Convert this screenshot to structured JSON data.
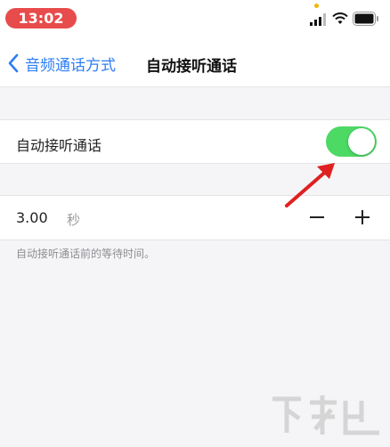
{
  "status": {
    "time": "13:02"
  },
  "nav": {
    "back_label": "音频通话方式",
    "title": "自动接听通话"
  },
  "auto_answer": {
    "label": "自动接听通话",
    "enabled": true
  },
  "delay": {
    "value": "3.00",
    "unit": "秒",
    "minus_label": "−",
    "plus_label": "+"
  },
  "footnote": "自动接听通话前的等待时间。",
  "colors": {
    "time_pill": "#e84b4b",
    "link_blue": "#2d7df6",
    "toggle_on": "#4cd964",
    "annotation_red": "#e02020"
  },
  "icons": {
    "back": "chevron-left-icon",
    "signal": "cellular-signal-icon",
    "wifi": "wifi-icon",
    "battery": "battery-icon"
  }
}
